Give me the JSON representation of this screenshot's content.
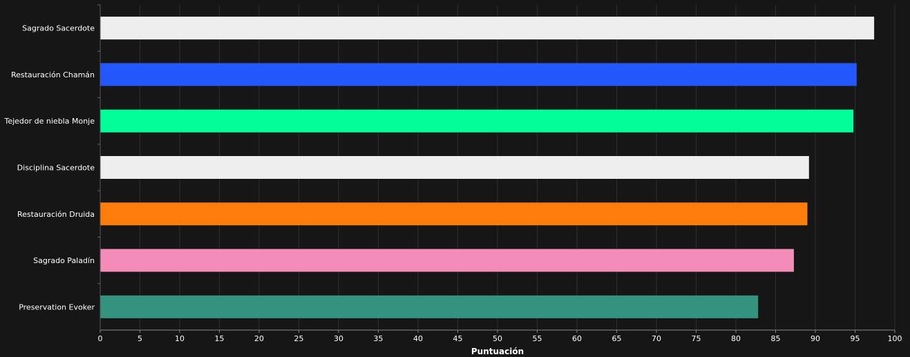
{
  "chart_data": {
    "type": "bar",
    "orientation": "horizontal",
    "title": "",
    "xlabel": "Puntuación",
    "ylabel": "",
    "xlim": [
      0,
      100
    ],
    "x_ticks": [
      0,
      5,
      10,
      15,
      20,
      25,
      30,
      35,
      40,
      45,
      50,
      55,
      60,
      65,
      70,
      75,
      80,
      85,
      90,
      95,
      100
    ],
    "grid": true,
    "legend": false,
    "background_color": "#161616",
    "grid_color": "#2e2e2e",
    "categories": [
      "Sagrado Sacerdote",
      "Restauración Chamán",
      "Tejedor de niebla Monje",
      "Disciplina Sacerdote",
      "Restauración Druida",
      "Sagrado Paladín",
      "Preservation Evoker"
    ],
    "values": [
      97.4,
      95.2,
      94.8,
      89.2,
      89.0,
      87.3,
      82.8
    ],
    "colors": [
      "#eeeeee",
      "#2458ff",
      "#00ff98",
      "#eeeeee",
      "#ff7c0a",
      "#f48cba",
      "#33937f"
    ]
  }
}
